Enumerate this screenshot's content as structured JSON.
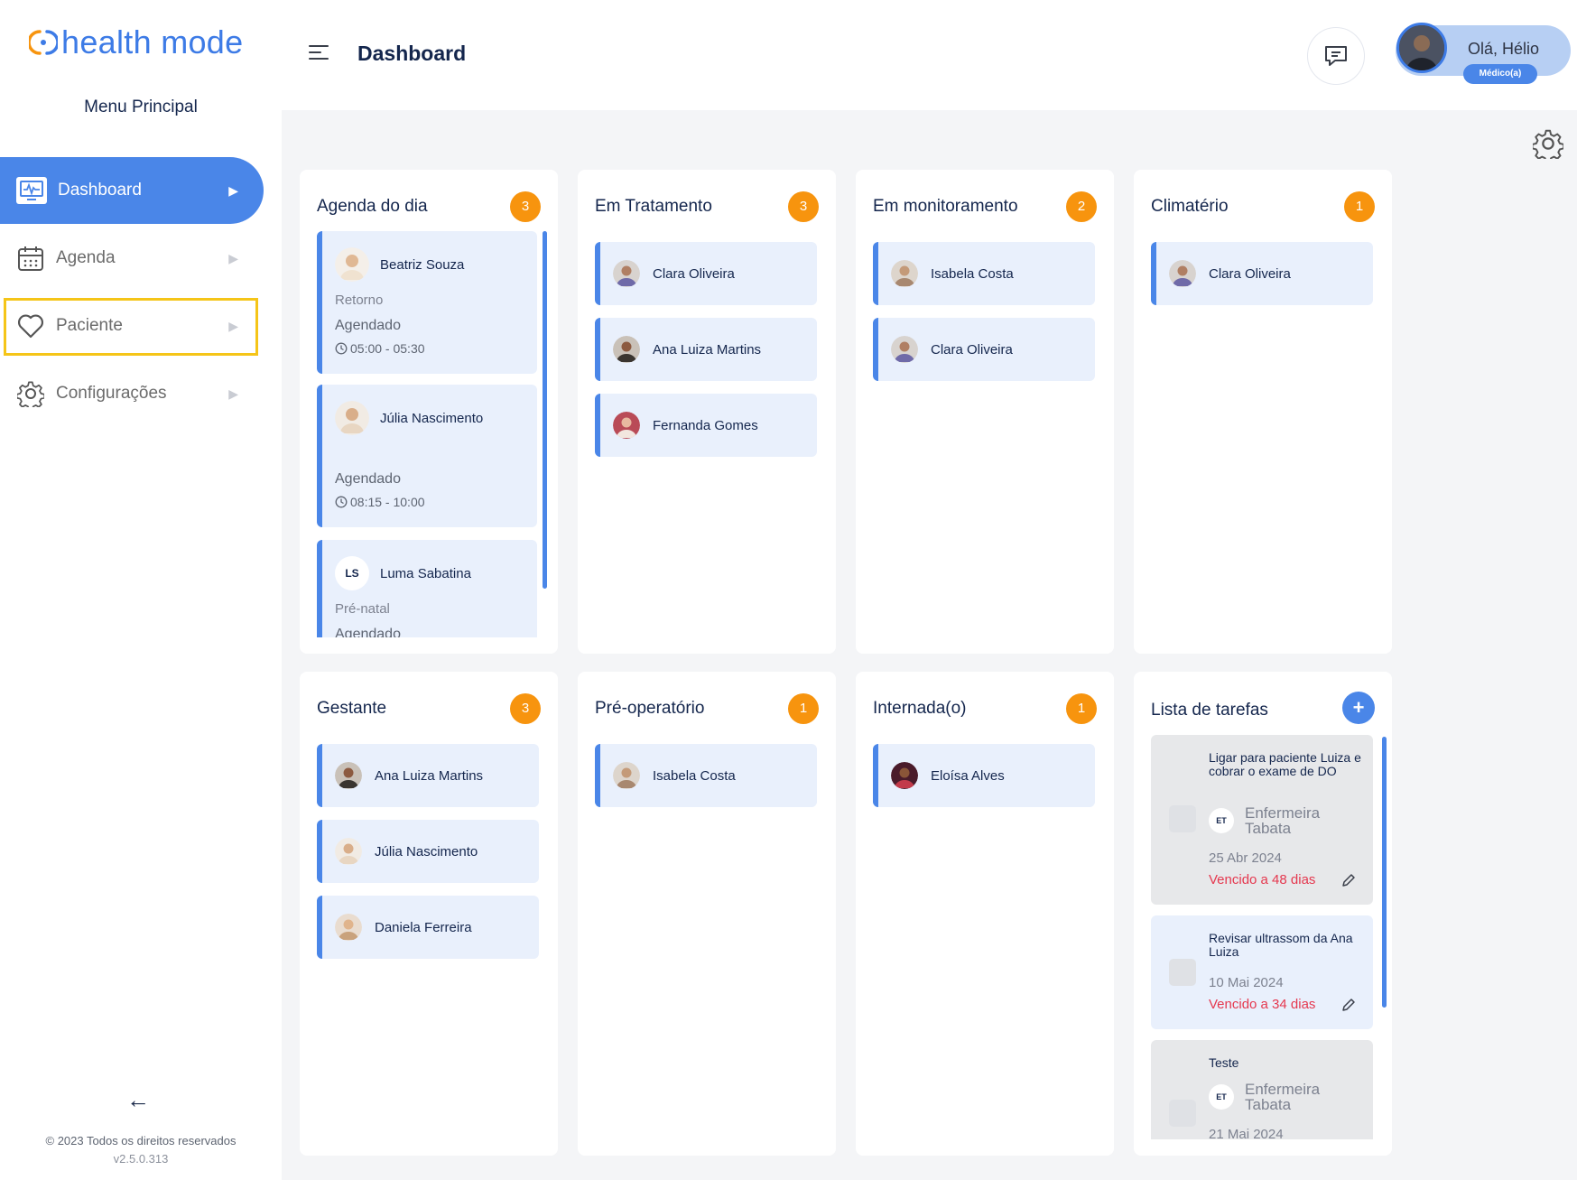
{
  "app": {
    "logo_text": "health mode"
  },
  "sidebar": {
    "menu_title": "Menu Principal",
    "items": [
      {
        "label": "Dashboard",
        "icon": "dashboard-monitor-icon",
        "active": true
      },
      {
        "label": "Agenda",
        "icon": "calendar-icon"
      },
      {
        "label": "Paciente",
        "icon": "heart-icon"
      },
      {
        "label": "Configurações",
        "icon": "gear-icon"
      }
    ],
    "copyright": "© 2023 Todos os direitos reservados",
    "version": "v2.5.0.313"
  },
  "header": {
    "title": "Dashboard",
    "user_greeting": "Olá, Hélio",
    "user_role": "Médico(a)"
  },
  "columns": [
    {
      "title": "Agenda do dia",
      "count": "3",
      "appointments": [
        {
          "name": "Beatriz Souza",
          "type": "Retorno",
          "status": "Agendado",
          "time": "05:00 - 05:30"
        },
        {
          "name": "Júlia Nascimento",
          "type": "",
          "status": "Agendado",
          "time": "08:15 - 10:00"
        },
        {
          "name": "Luma Sabatina",
          "initials": "LS",
          "type": "Pré-natal",
          "status": "Agendado",
          "time": ""
        }
      ]
    },
    {
      "title": "Em Tratamento",
      "count": "3",
      "patients": [
        "Clara Oliveira",
        "Ana Luiza Martins",
        "Fernanda Gomes"
      ]
    },
    {
      "title": "Em monitoramento",
      "count": "2",
      "patients": [
        "Isabela  Costa",
        "Clara Oliveira"
      ]
    },
    {
      "title": "Climatério",
      "count": "1",
      "patients": [
        "Clara Oliveira"
      ]
    },
    {
      "title": "Gestante",
      "count": "3",
      "patients": [
        "Ana Luiza Martins",
        "Júlia Nascimento",
        "Daniela Ferreira"
      ]
    },
    {
      "title": "Pré-operatório",
      "count": "1",
      "patients": [
        "Isabela  Costa"
      ]
    },
    {
      "title": "Internada(o)",
      "count": "1",
      "patients": [
        "Eloísa Alves"
      ]
    },
    {
      "title": "Lista de tarefas",
      "add_label": "+",
      "tasks": [
        {
          "title": "Ligar para paciente Luiza e cobrar o exame de DO",
          "assignee_initials": "ET",
          "assignee": "Enfermeira Tabata",
          "date": "25 Abr 2024",
          "due": "Vencido a 48 dias"
        },
        {
          "title": "Revisar ultrassom da Ana Luiza",
          "date": "10 Mai 2024",
          "due": "Vencido a 34 dias"
        },
        {
          "title": "Teste",
          "assignee_initials": "ET",
          "assignee": "Enfermeira Tabata",
          "date": "21 Mai 2024"
        }
      ]
    }
  ],
  "colors": {
    "primary": "#4a86e8",
    "badge": "#f7940e",
    "overdue": "#e5384f",
    "highlight": "#f5c518"
  }
}
